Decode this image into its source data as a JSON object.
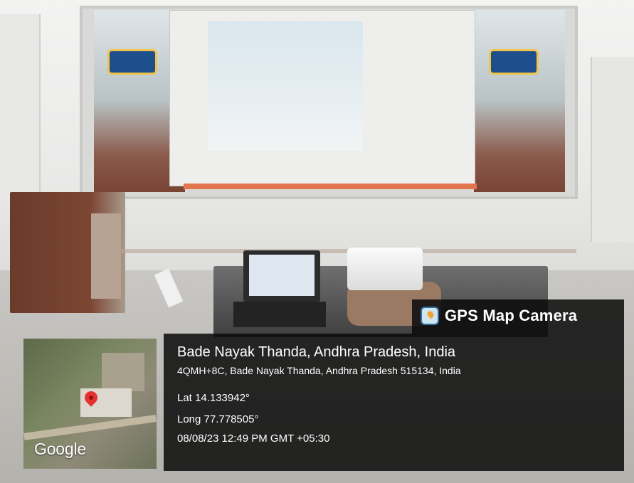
{
  "brand": {
    "icon": "map-camera-icon",
    "label": "GPS Map Camera"
  },
  "location": {
    "title": "Bade Nayak Thanda, Andhra Pradesh, India",
    "address": "4QMH+8C, Bade Nayak Thanda, Andhra Pradesh 515134, India",
    "latitude": "Lat 14.133942°",
    "longitude": "Long 77.778505°",
    "timestamp": "08/08/23 12:49 PM GMT +05:30"
  },
  "map": {
    "provider_label": "Google",
    "icon": "location-pin-icon"
  },
  "colors": {
    "overlay": "#0a0a0a",
    "pin": "#e5312f",
    "text": "#ffffff"
  }
}
